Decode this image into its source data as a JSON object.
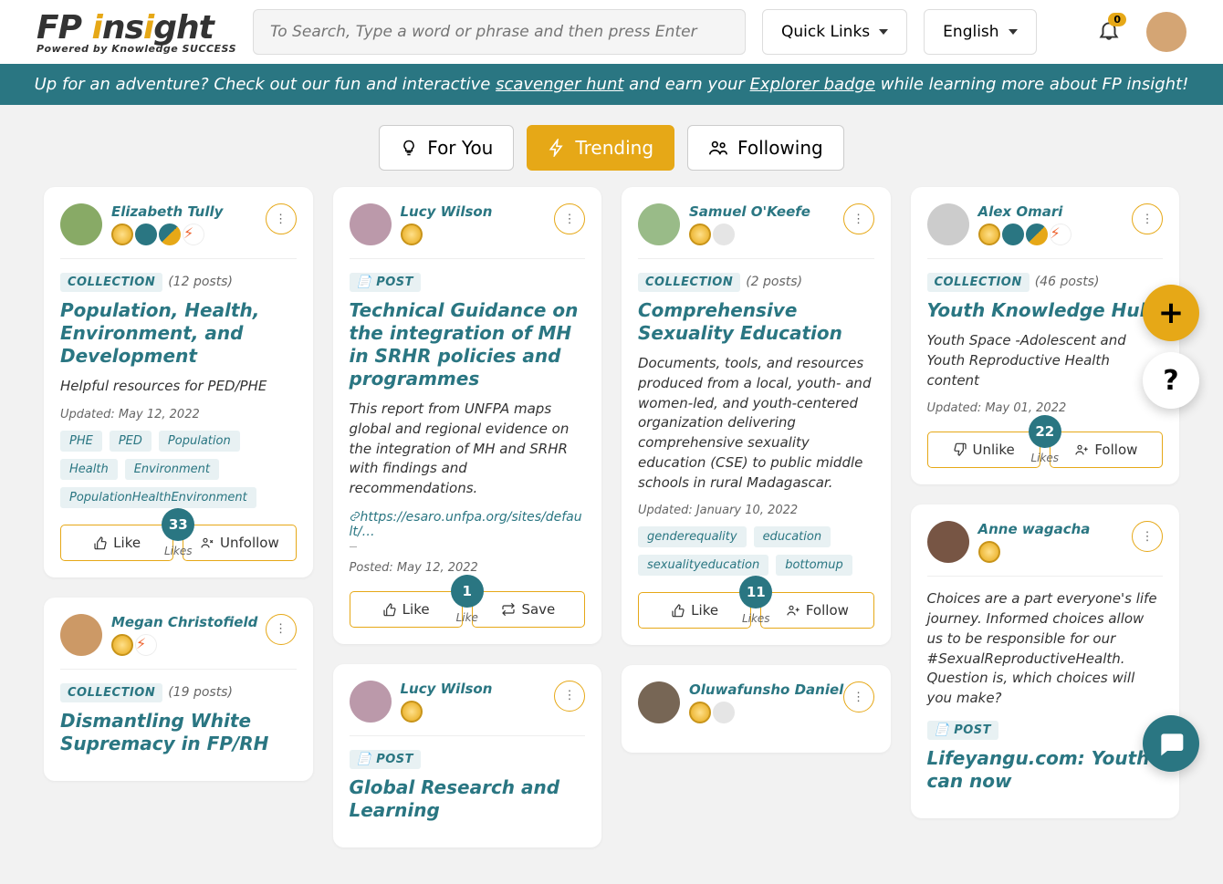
{
  "header": {
    "logo_main": "FP insight",
    "logo_sub": "Powered by Knowledge SUCCESS",
    "search_placeholder": "To Search, Type a word or phrase and then press Enter",
    "quick_links": "Quick Links",
    "language": "English",
    "notifications": "0"
  },
  "banner": {
    "pre": "Up for an adventure? Check out our fun and interactive ",
    "link1": "scavenger hunt",
    "mid": " and earn your ",
    "link2": "Explorer badge",
    "post": " while learning more about FP insight!"
  },
  "tabs": {
    "for_you": "For You",
    "trending": "Trending",
    "following": "Following"
  },
  "labels": {
    "collection": "COLLECTION",
    "post": "POST",
    "like": "Like",
    "unlike": "Unlike",
    "likes_word_s": "Like",
    "likes_word_p": "Likes",
    "unfollow": "Unfollow",
    "follow": "Follow",
    "save": "Save",
    "updated": "Updated: ",
    "posted": "Posted: "
  },
  "cards": {
    "c1": {
      "author": "Elizabeth Tully",
      "type": "COLLECTION",
      "count": "(12 posts)",
      "title": "Population, Health, Environment, and Development",
      "desc": "Helpful resources for PED/PHE",
      "meta": "Updated: May 12, 2022",
      "tags": [
        "PHE",
        "PED",
        "Population",
        "Health",
        "Environment",
        "PopulationHealthEnvironment"
      ],
      "likes": "33",
      "likeword": "Likes",
      "btn1": "Like",
      "btn2": "Unfollow"
    },
    "c2": {
      "author": "Megan Christofield",
      "type": "COLLECTION",
      "count": "(19 posts)",
      "title": "Dismantling White Supremacy in FP/RH"
    },
    "c3": {
      "author": "Lucy Wilson",
      "type": "POST",
      "title": "Technical Guidance on the integration of MH in SRHR policies and programmes",
      "desc": "This report from UNFPA maps global and regional evidence on the integration of MH and SRHR with findings and recommendations.",
      "link": "https://esaro.unfpa.org/sites/default/…",
      "meta": "Posted: May 12, 2022",
      "likes": "1",
      "likeword": "Like",
      "btn1": "Like",
      "btn2": "Save"
    },
    "c4": {
      "author": "Lucy Wilson",
      "type": "POST",
      "title": "Global Research and Learning"
    },
    "c5": {
      "author": "Samuel O'Keefe",
      "type": "COLLECTION",
      "count": "(2 posts)",
      "title": "Comprehensive Sexuality Education",
      "desc": "Documents, tools, and resources produced from a local, youth- and women-led, and youth-centered organization delivering comprehensive sexuality education (CSE) to public middle schools in rural Madagascar.",
      "meta": "Updated: January 10, 2022",
      "tags": [
        "genderequality",
        "education",
        "sexualityeducation",
        "bottomup"
      ],
      "likes": "11",
      "likeword": "Likes",
      "btn1": "Like",
      "btn2": "Follow"
    },
    "c6": {
      "author": "Oluwafunsho Daniel"
    },
    "c7": {
      "author": "Alex Omari",
      "type": "COLLECTION",
      "count": "(46 posts)",
      "title": "Youth Knowledge Hub",
      "desc": "Youth Space -Adolescent and Youth Reproductive Health content",
      "meta": "Updated: May 01, 2022",
      "likes": "22",
      "likeword": "Likes",
      "btn1": "Unlike",
      "btn2": "Follow"
    },
    "c8": {
      "author": "Anne wagacha",
      "desc": "Choices are a part everyone's life journey. Informed choices allow us to be responsible for our #SexualReproductiveHealth. Question is, which choices will you make?",
      "type": "POST",
      "title": "Lifeyangu.com: Youth can now"
    }
  }
}
